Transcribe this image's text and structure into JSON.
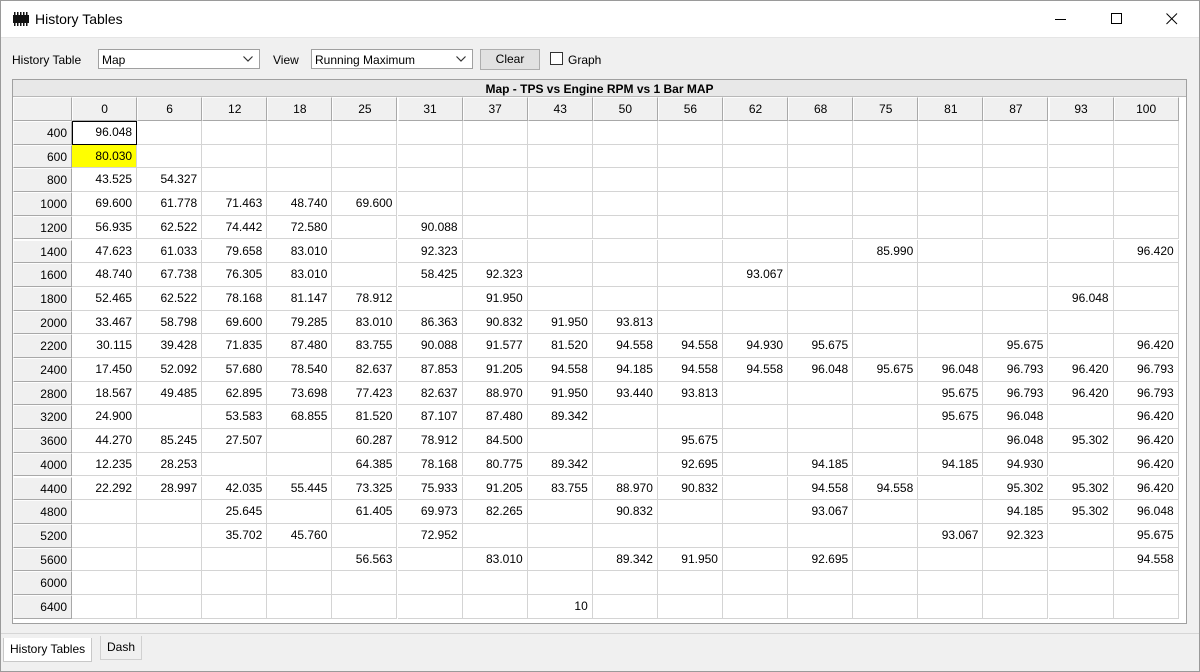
{
  "window": {
    "title": "History Tables"
  },
  "toolbar": {
    "history_table_label": "History Table",
    "history_table_value": "Map",
    "view_label": "View",
    "view_value": "Running Maximum",
    "clear_label": "Clear",
    "graph_label": "Graph",
    "graph_checked": false
  },
  "table": {
    "title": "Map - TPS vs Engine RPM vs 1 Bar MAP",
    "columns": [
      "0",
      "6",
      "12",
      "18",
      "25",
      "31",
      "37",
      "43",
      "50",
      "56",
      "62",
      "68",
      "75",
      "81",
      "87",
      "93",
      "100"
    ],
    "rows": [
      "400",
      "600",
      "800",
      "1000",
      "1200",
      "1400",
      "1600",
      "1800",
      "2000",
      "2200",
      "2400",
      "2800",
      "3200",
      "3600",
      "4000",
      "4400",
      "4800",
      "5200",
      "5600",
      "6000",
      "6400"
    ],
    "cells": [
      [
        "96.048",
        "",
        "",
        "",
        "",
        "",
        "",
        "",
        "",
        "",
        "",
        "",
        "",
        "",
        "",
        "",
        ""
      ],
      [
        "80.030",
        "",
        "",
        "",
        "",
        "",
        "",
        "",
        "",
        "",
        "",
        "",
        "",
        "",
        "",
        "",
        ""
      ],
      [
        "43.525",
        "54.327",
        "",
        "",
        "",
        "",
        "",
        "",
        "",
        "",
        "",
        "",
        "",
        "",
        "",
        "",
        ""
      ],
      [
        "69.600",
        "61.778",
        "71.463",
        "48.740",
        "69.600",
        "",
        "",
        "",
        "",
        "",
        "",
        "",
        "",
        "",
        "",
        "",
        ""
      ],
      [
        "56.935",
        "62.522",
        "74.442",
        "72.580",
        "",
        "90.088",
        "",
        "",
        "",
        "",
        "",
        "",
        "",
        "",
        "",
        "",
        ""
      ],
      [
        "47.623",
        "61.033",
        "79.658",
        "83.010",
        "",
        "92.323",
        "",
        "",
        "",
        "",
        "",
        "",
        "85.990",
        "",
        "",
        "",
        "96.420"
      ],
      [
        "48.740",
        "67.738",
        "76.305",
        "83.010",
        "",
        "58.425",
        "92.323",
        "",
        "",
        "",
        "93.067",
        "",
        "",
        "",
        "",
        "",
        ""
      ],
      [
        "52.465",
        "62.522",
        "78.168",
        "81.147",
        "78.912",
        "",
        "91.950",
        "",
        "",
        "",
        "",
        "",
        "",
        "",
        "",
        "96.048",
        ""
      ],
      [
        "33.467",
        "58.798",
        "69.600",
        "79.285",
        "83.010",
        "86.363",
        "90.832",
        "91.950",
        "93.813",
        "",
        "",
        "",
        "",
        "",
        "",
        "",
        ""
      ],
      [
        "30.115",
        "39.428",
        "71.835",
        "87.480",
        "83.755",
        "90.088",
        "91.577",
        "81.520",
        "94.558",
        "94.558",
        "94.930",
        "95.675",
        "",
        "",
        "95.675",
        "",
        "96.420"
      ],
      [
        "17.450",
        "52.092",
        "57.680",
        "78.540",
        "82.637",
        "87.853",
        "91.205",
        "94.558",
        "94.185",
        "94.558",
        "94.558",
        "96.048",
        "95.675",
        "96.048",
        "96.793",
        "96.420",
        "96.793"
      ],
      [
        "18.567",
        "49.485",
        "62.895",
        "73.698",
        "77.423",
        "82.637",
        "88.970",
        "91.950",
        "93.440",
        "93.813",
        "",
        "",
        "",
        "95.675",
        "96.793",
        "96.420",
        "96.793"
      ],
      [
        "24.900",
        "",
        "53.583",
        "68.855",
        "81.520",
        "87.107",
        "87.480",
        "89.342",
        "",
        "",
        "",
        "",
        "",
        "95.675",
        "96.048",
        "",
        "96.420"
      ],
      [
        "44.270",
        "85.245",
        "27.507",
        "",
        "60.287",
        "78.912",
        "84.500",
        "",
        "",
        "95.675",
        "",
        "",
        "",
        "",
        "96.048",
        "95.302",
        "96.420"
      ],
      [
        "12.235",
        "28.253",
        "",
        "",
        "64.385",
        "78.168",
        "80.775",
        "89.342",
        "",
        "92.695",
        "",
        "94.185",
        "",
        "94.185",
        "94.930",
        "",
        "96.420"
      ],
      [
        "22.292",
        "28.997",
        "42.035",
        "55.445",
        "73.325",
        "75.933",
        "91.205",
        "83.755",
        "88.970",
        "90.832",
        "",
        "94.558",
        "94.558",
        "",
        "95.302",
        "95.302",
        "96.420"
      ],
      [
        "",
        "",
        "25.645",
        "",
        "61.405",
        "69.973",
        "82.265",
        "",
        "90.832",
        "",
        "",
        "93.067",
        "",
        "",
        "94.185",
        "95.302",
        "96.048"
      ],
      [
        "",
        "",
        "35.702",
        "45.760",
        "",
        "72.952",
        "",
        "",
        "",
        "",
        "",
        "",
        "",
        "93.067",
        "92.323",
        "",
        "95.675"
      ],
      [
        "",
        "",
        "",
        "",
        "56.563",
        "",
        "83.010",
        "",
        "89.342",
        "91.950",
        "",
        "92.695",
        "",
        "",
        "",
        "",
        "94.558"
      ],
      [
        "",
        "",
        "",
        "",
        "",
        "",
        "",
        "",
        "",
        "",
        "",
        "",
        "",
        "",
        "",
        "",
        ""
      ],
      [
        "",
        "",
        "",
        "",
        "",
        "",
        "",
        "10",
        "",
        "",
        "",
        "",
        "",
        "",
        "",
        "",
        ""
      ]
    ],
    "highlight_color": "#ffff00"
  },
  "tabs": [
    {
      "label": "History Tables",
      "active": true
    },
    {
      "label": "Dash",
      "active": false
    }
  ]
}
